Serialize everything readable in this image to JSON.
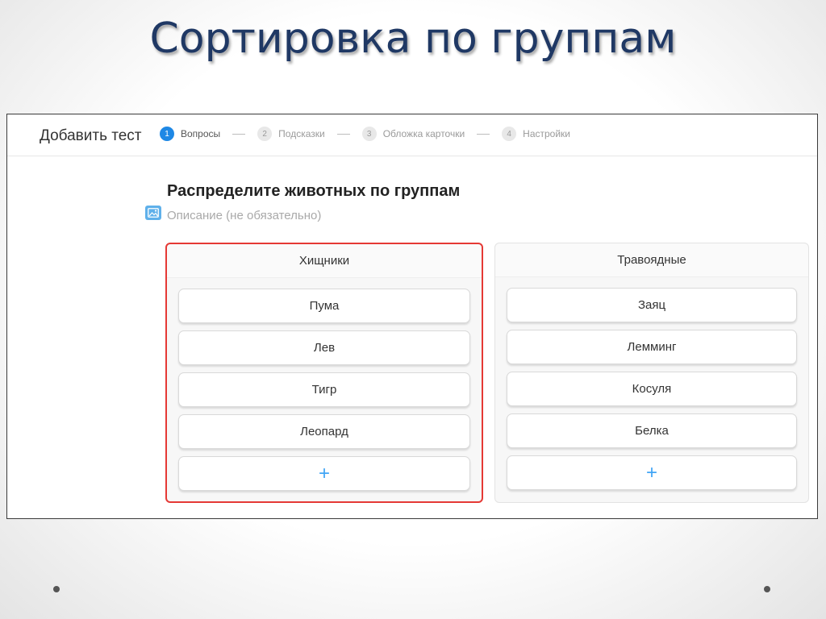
{
  "slide": {
    "title": "Сортировка по группам"
  },
  "app": {
    "title": "Добавить тест",
    "steps": [
      {
        "num": "1",
        "label": "Вопросы",
        "active": true
      },
      {
        "num": "2",
        "label": "Подсказки",
        "active": false
      },
      {
        "num": "3",
        "label": "Обложка карточки",
        "active": false
      },
      {
        "num": "4",
        "label": "Настройки",
        "active": false
      }
    ],
    "separator": "—"
  },
  "question": {
    "title": "Распределите животных по группам",
    "description_placeholder": "Описание (не обязательно)",
    "description_icon": "image-icon"
  },
  "groups": [
    {
      "name": "Хищники",
      "highlighted": true,
      "items": [
        "Пума",
        "Лев",
        "Тигр",
        "Леопард"
      ],
      "add_label": "+"
    },
    {
      "name": "Травоядные",
      "highlighted": false,
      "items": [
        "Заяц",
        "Лемминг",
        "Косуля",
        "Белка"
      ],
      "add_label": "+"
    }
  ],
  "colors": {
    "title": "#1f3864",
    "accent": "#1e88e5",
    "add": "#42a5f5",
    "highlight_border": "#e53935"
  }
}
